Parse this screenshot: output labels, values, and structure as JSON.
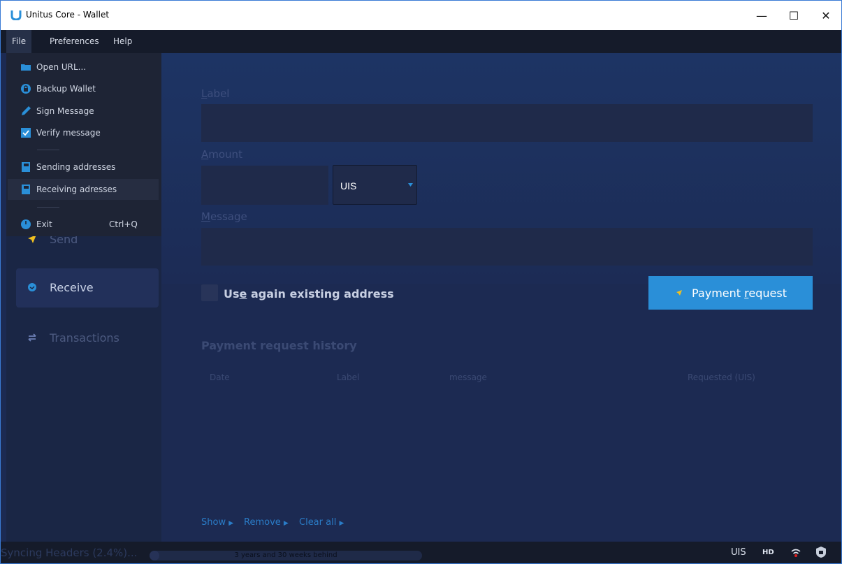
{
  "window": {
    "title": "Unitus Core - Wallet",
    "minimize": "—",
    "maximize": "☐",
    "close": "✕"
  },
  "menubar": {
    "items": [
      {
        "label": "File"
      },
      {
        "label": "Preferences"
      },
      {
        "label": "Help"
      }
    ]
  },
  "file_menu": {
    "items": [
      {
        "label": "Open URL...",
        "icon": "folder-icon"
      },
      {
        "label": "Backup Wallet",
        "icon": "lock-circle-icon"
      },
      {
        "label": "Sign Message",
        "icon": "pen-icon"
      },
      {
        "label": "Verify message",
        "icon": "checkbox-icon"
      },
      {
        "label": "Sending addresses",
        "icon": "address-book-icon"
      },
      {
        "label": "Receiving adresses",
        "icon": "address-book-icon"
      },
      {
        "label": "Exit",
        "shortcut": "Ctrl+Q",
        "icon": "power-icon"
      }
    ]
  },
  "sidebar": {
    "items": [
      {
        "label": "Send"
      },
      {
        "label": "Receive"
      },
      {
        "label": "Transactions"
      }
    ]
  },
  "form": {
    "label_field": {
      "label_pre": "",
      "label_ul": "L",
      "label_post": "abel",
      "value": ""
    },
    "amount_field": {
      "label_pre": "",
      "label_ul": "A",
      "label_post": "mount",
      "value": ""
    },
    "unit": "UIS",
    "message_field": {
      "label_pre": "",
      "label_ul": "M",
      "label_post": "essage",
      "value": ""
    },
    "reuse": {
      "pre": "Us",
      "ul": "e",
      "post": " again existing address",
      "checked": false
    },
    "payment_button": {
      "pre": "Payment ",
      "ul": "r",
      "post": "equest"
    }
  },
  "history": {
    "title": "Payment request history",
    "columns": [
      "Date",
      "Label",
      "message",
      "Requested (UIS)"
    ]
  },
  "actions": {
    "show": "Show",
    "remove": "Remove",
    "clear_all": "Clear all"
  },
  "statusbar": {
    "sync_text": "Syncing Headers (2.4%)...",
    "progress_text": "3 years and 30 weeks behind",
    "progress": 0.024,
    "unit": "UIS",
    "hd": "HD"
  },
  "colors": {
    "accent": "#2a8fd8",
    "background": "#1c2a52",
    "menubar": "#151b2a"
  }
}
